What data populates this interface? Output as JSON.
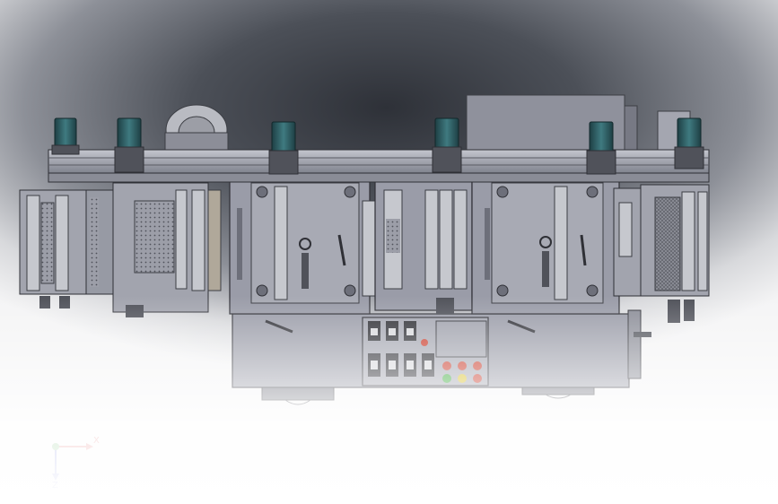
{
  "triad": {
    "x_label": "X",
    "z_label": "Z"
  },
  "colors": {
    "frame": "#8c8e99",
    "plate": "#9a9ca8",
    "plate_dark": "#6d6f7a",
    "motor": "#2f5f63",
    "motor_dark": "#1e3f44",
    "rail": "#a7aab4",
    "button_red": "#c83a2a",
    "button_green": "#3aa83a",
    "button_yellow": "#d8c02a"
  }
}
